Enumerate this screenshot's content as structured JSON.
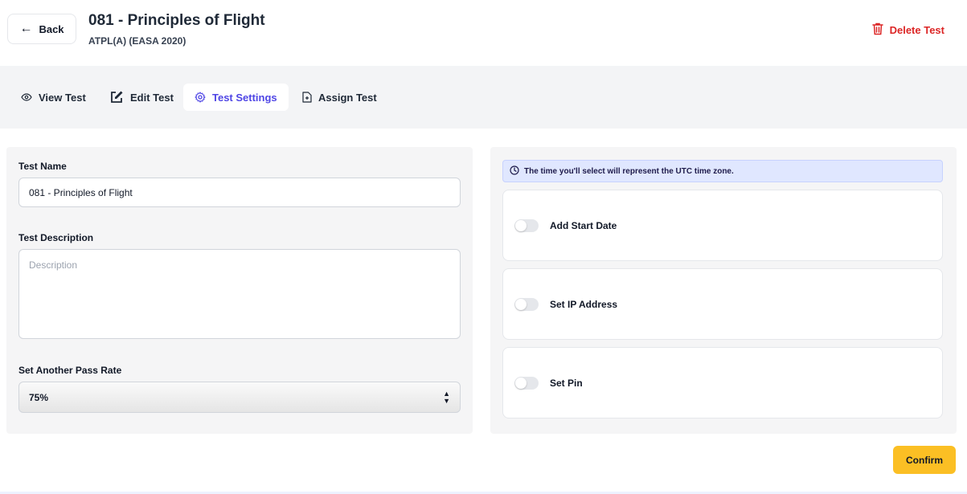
{
  "header": {
    "back_label": "Back",
    "title": "081 - Principles of Flight",
    "subtitle": "ATPL(A) (EASA 2020)",
    "delete_label": "Delete Test"
  },
  "tabs": [
    {
      "label": "View Test",
      "icon": "eye-icon",
      "active": false
    },
    {
      "label": "Edit Test",
      "icon": "edit-icon",
      "active": false
    },
    {
      "label": "Test Settings",
      "icon": "gear-icon",
      "active": true
    },
    {
      "label": "Assign Test",
      "icon": "document-plus-icon",
      "active": false
    }
  ],
  "form": {
    "name_label": "Test Name",
    "name_value": "081 - Principles of Flight",
    "description_label": "Test Description",
    "description_placeholder": "Description",
    "pass_rate_label": "Set Another Pass Rate",
    "pass_rate_value": "75%"
  },
  "settings": {
    "info_text": "The time you'll select will represent the UTC time zone.",
    "toggles": [
      {
        "label": "Add Start Date",
        "on": false
      },
      {
        "label": "Set IP Address",
        "on": false
      },
      {
        "label": "Set Pin",
        "on": false
      }
    ]
  },
  "confirm_label": "Confirm",
  "colors": {
    "accent": "#4f46e5",
    "danger": "#dc2626",
    "confirm": "#fbbf24"
  }
}
